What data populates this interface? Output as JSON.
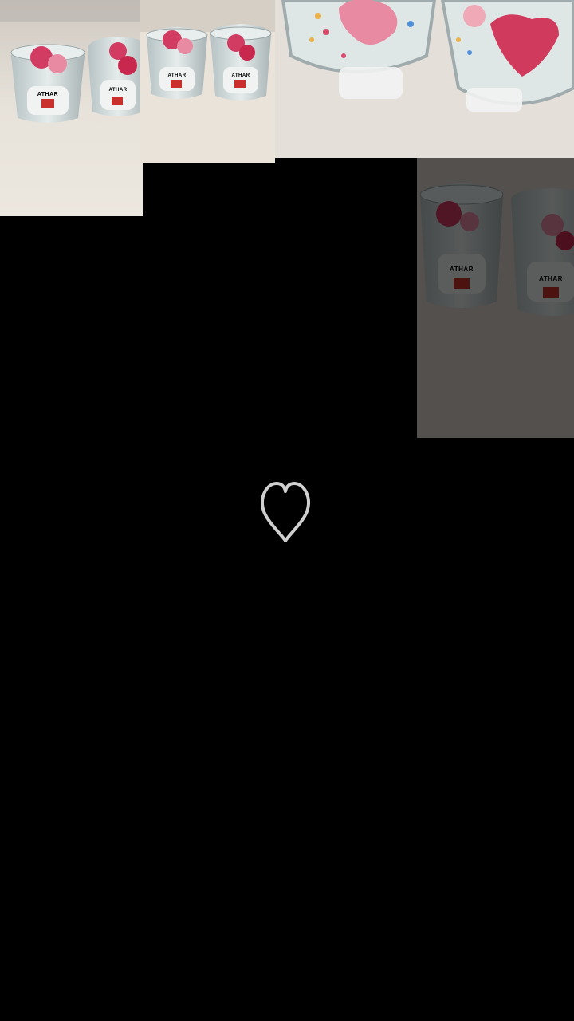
{
  "screen": {
    "background": "#000000"
  },
  "photos": [
    {
      "name": "candle-photo-1",
      "state": "full"
    },
    {
      "name": "candle-photo-2",
      "state": "full"
    },
    {
      "name": "candle-photo-3",
      "state": "zoomed"
    },
    {
      "name": "candle-photo-4",
      "state": "dimmed"
    }
  ],
  "candle": {
    "brand_label": "ATHAR",
    "accent_pink": "#d94b6c",
    "label_red": "#c9302c"
  },
  "like_button": {
    "icon": "heart-outline-icon",
    "color": "#cfcfcf"
  }
}
